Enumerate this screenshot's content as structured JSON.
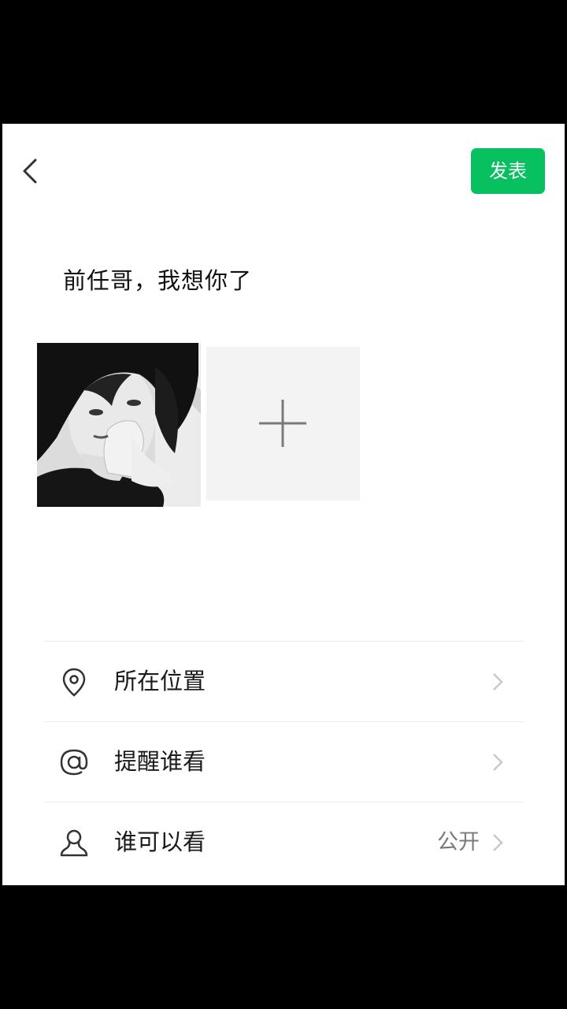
{
  "header": {
    "back_icon": "chevron-left-icon",
    "publish_label": "发表",
    "publish_color": "#07c160"
  },
  "post": {
    "text": "前任哥，我想你了",
    "photos": [
      {
        "description_icon": "photo-thumbnail"
      }
    ],
    "add_photo_icon": "plus-icon"
  },
  "menu": {
    "items": [
      {
        "icon": "location-pin-icon",
        "label": "所在位置",
        "value": ""
      },
      {
        "icon": "at-sign-icon",
        "label": "提醒谁看",
        "value": ""
      },
      {
        "icon": "person-icon",
        "label": "谁可以看",
        "value": "公开"
      }
    ]
  }
}
